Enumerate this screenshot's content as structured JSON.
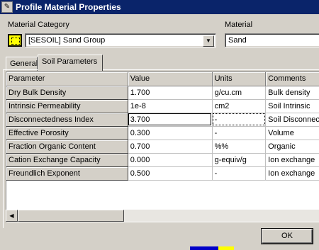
{
  "window": {
    "title": "Profile Material Properties",
    "icon": "app-icon",
    "icon_glyph": "✎"
  },
  "material_category": {
    "label": "Material Category",
    "value": "[SESOIL] Sand Group",
    "swatch_color": "#ffff00",
    "dropdown_glyph": "▼"
  },
  "material": {
    "label": "Material",
    "value": "Sand"
  },
  "tabs": [
    {
      "label": "General",
      "active": false
    },
    {
      "label": "Soil Parameters",
      "active": true
    }
  ],
  "grid": {
    "columns": [
      "Parameter",
      "Value",
      "Units",
      "Comments"
    ],
    "rows": [
      {
        "parameter": "Dry Bulk Density",
        "value": "1.700",
        "units": "g/cu.cm",
        "comments": "Bulk  density"
      },
      {
        "parameter": "Intrinsic Permeability",
        "value": "1e-8",
        "units": "cm2",
        "comments": "Soil Intrinsic"
      },
      {
        "parameter": "Disconnectedness Index",
        "value": "3.700",
        "units": "-",
        "comments": "Soil Disconnect"
      },
      {
        "parameter": "Effective Porosity",
        "value": "0.300",
        "units": "-",
        "comments": "Volume"
      },
      {
        "parameter": "Fraction Organic Content",
        "value": "0.700",
        "units": "%%",
        "comments": "Organic"
      },
      {
        "parameter": "Cation Exchange Capacity",
        "value": "0.000",
        "units": "g-equiv/g",
        "comments": "Ion exchange"
      },
      {
        "parameter": "Freundlich Exponent",
        "value": "0.500",
        "units": "-",
        "comments": "Ion exchange"
      }
    ]
  },
  "scrollbar": {
    "left_glyph": "◀"
  },
  "buttons": {
    "ok_label": "OK"
  }
}
